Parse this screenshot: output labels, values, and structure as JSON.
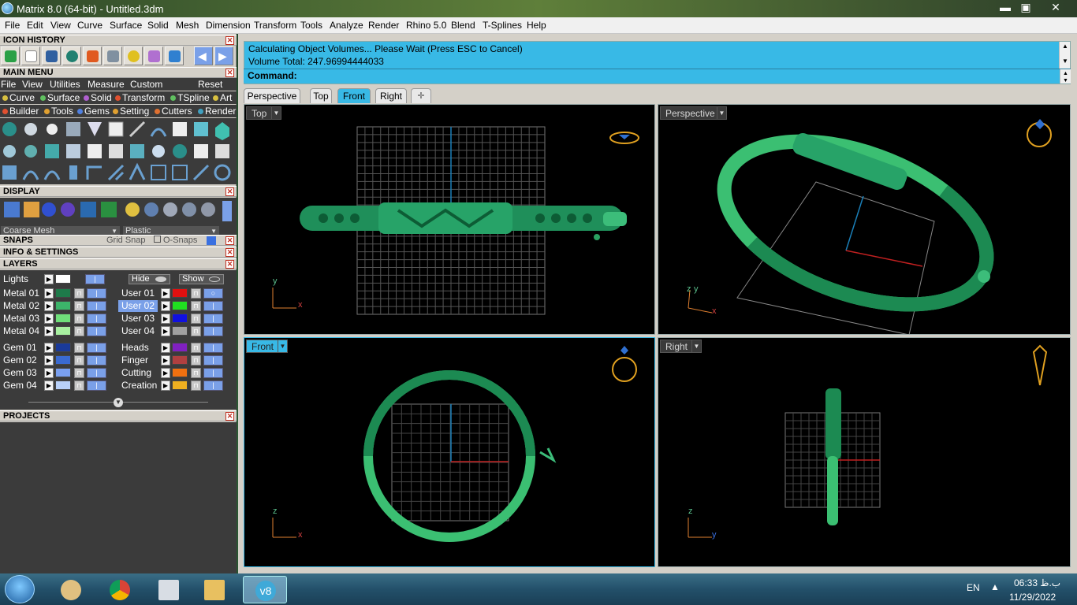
{
  "window": {
    "title": "Matrix 8.0 (64-bit) - Untitled.3dm",
    "minimize": "▬",
    "maximize": "▣",
    "close": "✕"
  },
  "menubar": [
    "File",
    "Edit",
    "View",
    "Curve",
    "Surface",
    "Solid",
    "Mesh",
    "Dimension",
    "Transform",
    "Tools",
    "Analyze",
    "Render",
    "Rhino 5.0",
    "Blend",
    "T-Splines",
    "Help"
  ],
  "panel": {
    "icon_history_title": "ICON HISTORY",
    "main_menu_title": "MAIN MENU",
    "main_menu_row1": [
      "File",
      "View",
      "Utilities",
      "Measure",
      "Custom",
      "Reset"
    ],
    "main_menu_row2": [
      {
        "label": "Curve",
        "color": "#d8c040"
      },
      {
        "label": "Surface",
        "color": "#60c060"
      },
      {
        "label": "Solid",
        "color": "#b060d0"
      },
      {
        "label": "Transform",
        "color": "#e05030"
      },
      {
        "label": "TSpline",
        "color": "#60c060"
      },
      {
        "label": "Art",
        "color": "#d8c040"
      }
    ],
    "main_menu_row3": [
      {
        "label": "Builder",
        "color": "#e05030"
      },
      {
        "label": "Tools",
        "color": "#e0a030"
      },
      {
        "label": "Gems",
        "color": "#5080e0"
      },
      {
        "label": "Setting",
        "color": "#e0a030"
      },
      {
        "label": "Cutters",
        "color": "#e07030"
      },
      {
        "label": "Render",
        "color": "#40a0c0"
      }
    ],
    "display_title": "DISPLAY",
    "display_mesh": "Coarse Mesh",
    "display_material": "Plastic",
    "snaps_title": "SNAPS",
    "grid_snap": "Grid Snap",
    "o_snaps": "O-Snaps",
    "info_title": "INFO & SETTINGS",
    "layers_title": "LAYERS",
    "lights_label": "Lights",
    "hide_label": "Hide",
    "show_label": "Show",
    "layers_left": [
      {
        "name": "Metal 01",
        "color": "#1e7a4a"
      },
      {
        "name": "Metal 02",
        "color": "#3cb46a"
      },
      {
        "name": "Metal 03",
        "color": "#6fe07a"
      },
      {
        "name": "Metal 04",
        "color": "#a8f0a0"
      },
      {
        "name": "Gem 01",
        "color": "#1a3a9a"
      },
      {
        "name": "Gem 02",
        "color": "#3a6ad0"
      },
      {
        "name": "Gem 03",
        "color": "#7aa0f0"
      },
      {
        "name": "Gem 04",
        "color": "#b8d0f8"
      }
    ],
    "layers_right": [
      {
        "name": "User 01",
        "color": "#e01010"
      },
      {
        "name": "User 02",
        "color": "#20e020"
      },
      {
        "name": "User 03",
        "color": "#1010e0"
      },
      {
        "name": "User 04",
        "color": "#a0a0a0"
      },
      {
        "name": "Heads",
        "color": "#8020c0"
      },
      {
        "name": "Finger",
        "color": "#b04040"
      },
      {
        "name": "Cutting",
        "color": "#f07010"
      },
      {
        "name": "Creation",
        "color": "#f0b020"
      }
    ],
    "projects_title": "PROJECTS"
  },
  "command": {
    "line1": "Calculating Object Volumes... Please Wait (Press ESC to Cancel)",
    "line2": "Volume Total: 247.96994444033",
    "prompt": "Command:"
  },
  "view_tabs": [
    {
      "label": "Perspective",
      "active": false
    },
    {
      "label": "Top",
      "active": false
    },
    {
      "label": "Front",
      "active": true
    },
    {
      "label": "Right",
      "active": false
    },
    {
      "label": "✛",
      "active": false
    }
  ],
  "viewports": {
    "top": {
      "label": "Top",
      "axes": [
        "y",
        "x"
      ]
    },
    "perspective": {
      "label": "Perspective",
      "axes": [
        "z",
        "y",
        "x"
      ]
    },
    "front": {
      "label": "Front",
      "axes": [
        "z",
        "x"
      ]
    },
    "right": {
      "label": "Right",
      "axes": [
        "z",
        "y"
      ]
    }
  },
  "taskbar": {
    "lang": "EN",
    "time": "06:33 ب.ظ",
    "date": "11/29/2022",
    "active_app": "v8"
  }
}
